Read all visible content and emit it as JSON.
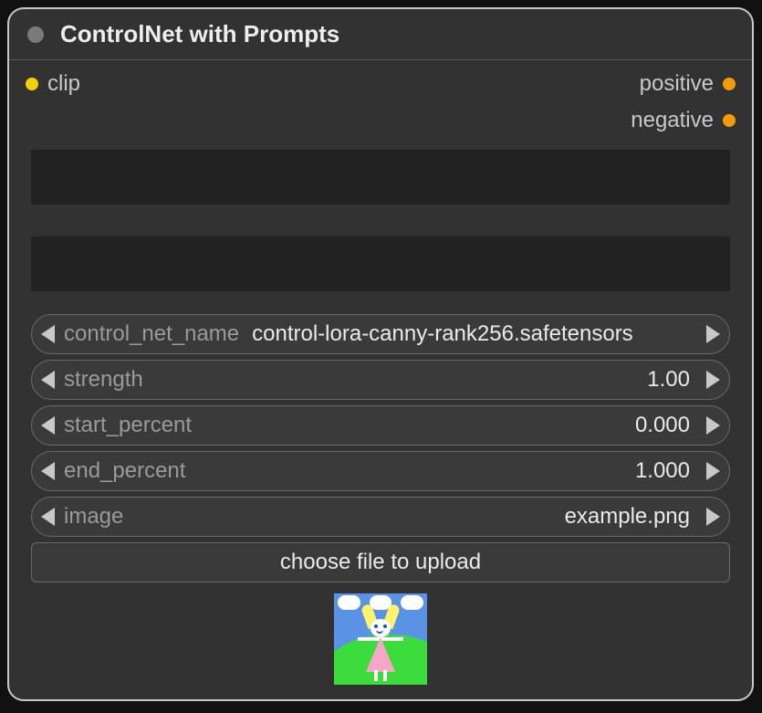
{
  "node": {
    "title": "ControlNet with Prompts",
    "inputs": {
      "clip": "clip"
    },
    "outputs": {
      "positive": "positive",
      "negative": "negative"
    }
  },
  "prompts": {
    "positive_text": "",
    "negative_text": ""
  },
  "params": {
    "control_net_name": {
      "label": "control_net_name",
      "value": "control-lora-canny-rank256.safetensors"
    },
    "strength": {
      "label": "strength",
      "value": "1.00"
    },
    "start_percent": {
      "label": "start_percent",
      "value": "0.000"
    },
    "end_percent": {
      "label": "end_percent",
      "value": "1.000"
    },
    "image": {
      "label": "image",
      "value": "example.png"
    }
  },
  "upload_button": "choose file to upload"
}
